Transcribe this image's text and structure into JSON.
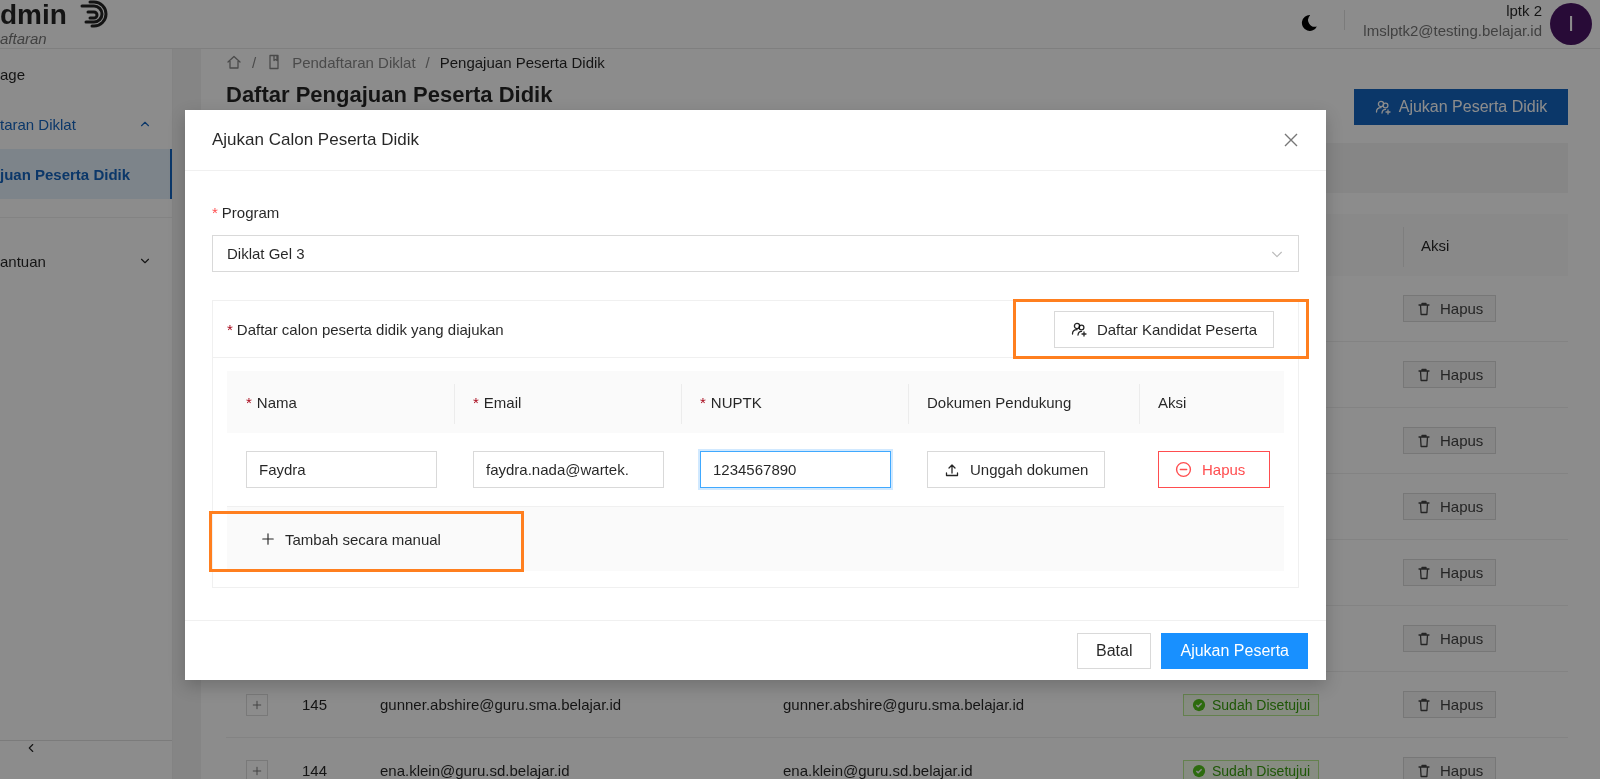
{
  "header": {
    "title": "dmin",
    "subtitle": "aftaran",
    "user_name": "lptk 2",
    "user_email": "lmslptk2@testing.belajar.id",
    "avatar_initial": "I"
  },
  "sidebar": {
    "items": [
      {
        "label": "age",
        "kind": "link",
        "selected": false
      },
      {
        "label": "taran Diklat",
        "kind": "group",
        "selected": false,
        "expanded": true
      },
      {
        "label": "juan Peserta Didik",
        "kind": "link",
        "selected": true
      },
      {
        "label": "antuan",
        "kind": "group",
        "selected": false,
        "expanded": false
      }
    ]
  },
  "breadcrumb": [
    {
      "separator": "/",
      "label": "Pendaftaran Diklat",
      "kind": "section"
    },
    {
      "separator": "/",
      "label": "Pengajuan Peserta Didik",
      "kind": "current"
    }
  ],
  "page_title": "Daftar Pengajuan Peserta Didik",
  "primary_button": "Ajukan Peserta Didik",
  "table": {
    "columns": [
      {
        "label": "Aksi"
      }
    ],
    "rows": [
      {
        "action": "Hapus"
      },
      {
        "action": "Hapus"
      },
      {
        "action": "Hapus"
      },
      {
        "action": "Hapus"
      },
      {
        "action": "Hapus"
      },
      {
        "action": "Hapus"
      },
      {
        "number": "145",
        "email": "gunner.abshire@guru.sma.belajar.id",
        "username": "gunner.abshire@guru.sma.belajar.id",
        "status": "Sudah Disetujui",
        "action": "Hapus"
      },
      {
        "number": "144",
        "email": "ena.klein@guru.sd.belajar.id",
        "username": "ena.klein@guru.sd.belajar.id",
        "status": "Sudah Disetujui",
        "action": "Hapus"
      }
    ]
  },
  "modal": {
    "title": "Ajukan Calon Peserta Didik",
    "program": {
      "mark": "*",
      "label": "Program",
      "value": "Diklat Gel 3"
    },
    "list": {
      "mark": "*",
      "label": "Daftar calon peserta didik yang diajukan",
      "candidates_button": "Daftar Kandidat Peserta",
      "columns": [
        {
          "mark": "*",
          "label": "Nama"
        },
        {
          "mark": "*",
          "label": "Email"
        },
        {
          "mark": "*",
          "label": "NUPTK"
        },
        {
          "label": "Dokumen Pendukung"
        },
        {
          "label": "Aksi"
        }
      ],
      "rows": [
        {
          "name": {
            "value": "Faydra",
            "focused": false
          },
          "email": {
            "value": "faydra.nada@wartek.",
            "focused": false
          },
          "nuptk": {
            "value": "1234567890",
            "focused": true
          },
          "upload": "Unggah dokumen",
          "remove": "Hapus"
        }
      ],
      "add_manual": "Tambah secara manual"
    },
    "buttons": [
      {
        "label": "Batal",
        "kind": "secondary"
      },
      {
        "label": "Ajukan Peserta",
        "kind": "primary"
      }
    ]
  }
}
